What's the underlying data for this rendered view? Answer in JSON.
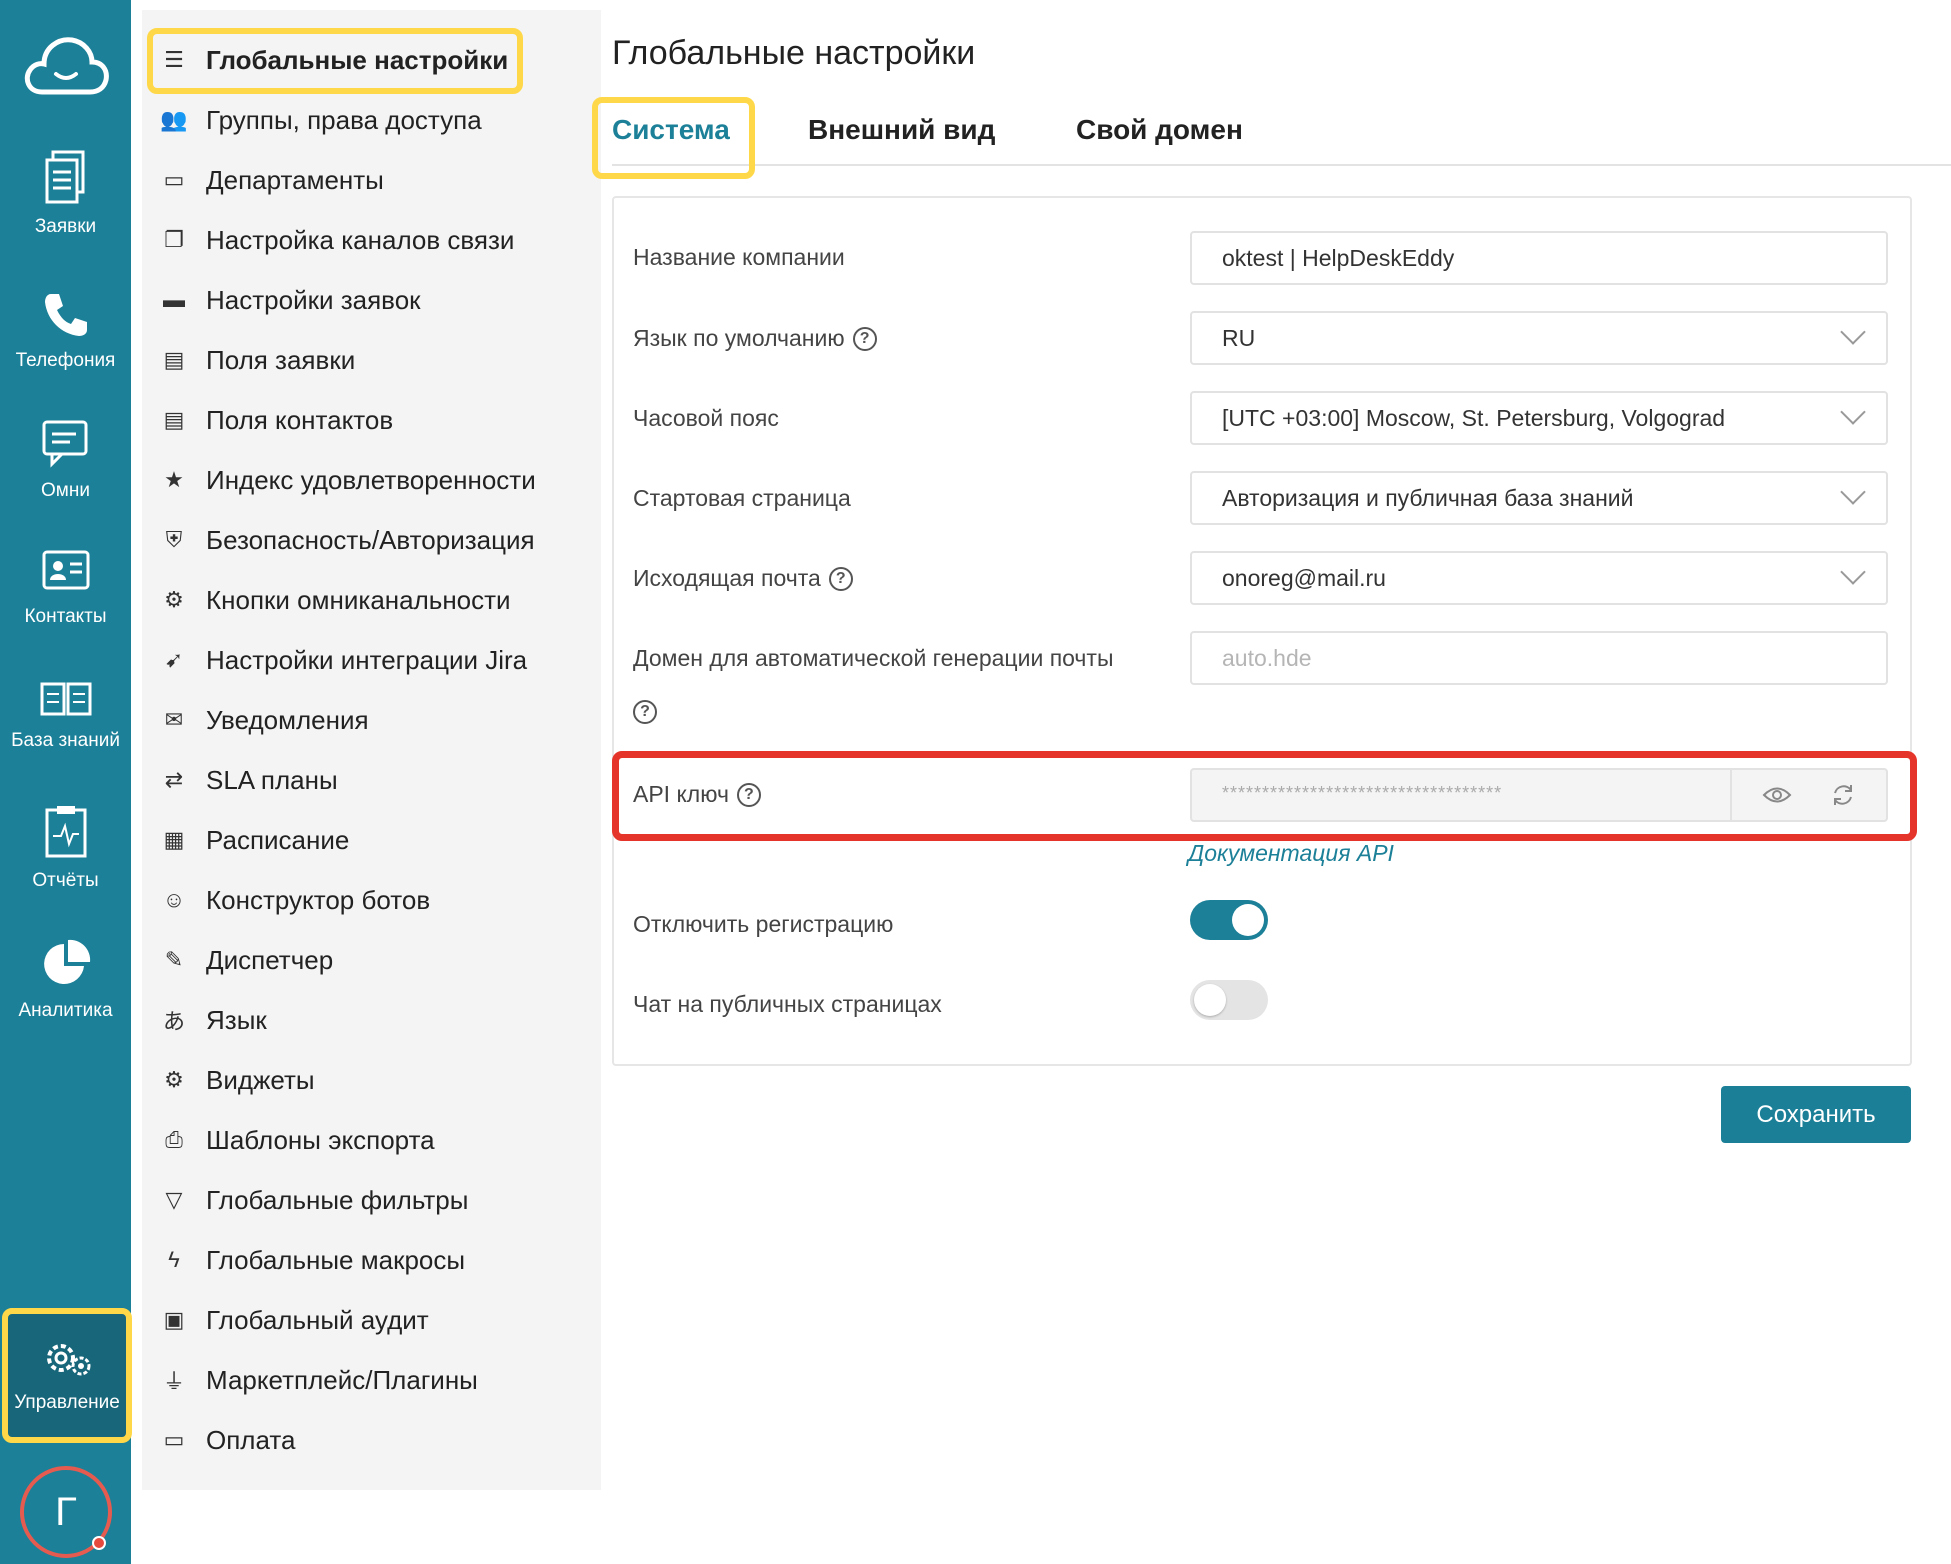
{
  "rail": {
    "items": [
      {
        "label": "Заявки",
        "icon": "tickets-icon"
      },
      {
        "label": "Телефония",
        "icon": "phone-icon"
      },
      {
        "label": "Омни",
        "icon": "chat-icon"
      },
      {
        "label": "Контакты",
        "icon": "contacts-icon"
      },
      {
        "label": "База знаний",
        "icon": "book-icon"
      },
      {
        "label": "Отчёты",
        "icon": "report-icon"
      },
      {
        "label": "Аналитика",
        "icon": "pie-chart-icon"
      }
    ],
    "active_label": "Управление",
    "avatar_letter": "Г"
  },
  "menu": {
    "items": [
      {
        "label": "Глобальные настройки",
        "icon": "sliders-icon"
      },
      {
        "label": "Группы, права доступа",
        "icon": "users-icon"
      },
      {
        "label": "Департаменты",
        "icon": "inbox-icon"
      },
      {
        "label": "Настройка каналов связи",
        "icon": "channels-icon"
      },
      {
        "label": "Настройки заявок",
        "icon": "window-icon"
      },
      {
        "label": "Поля заявки",
        "icon": "form-icon"
      },
      {
        "label": "Поля контактов",
        "icon": "form-icon"
      },
      {
        "label": "Индекс удовлетворенности",
        "icon": "star-icon"
      },
      {
        "label": "Безопасность/Авторизация",
        "icon": "shield-icon"
      },
      {
        "label": "Кнопки омниканальности",
        "icon": "gear-icon"
      },
      {
        "label": "Настройки интеграции Jira",
        "icon": "jira-icon"
      },
      {
        "label": "Уведомления",
        "icon": "envelope-icon"
      },
      {
        "label": "SLA планы",
        "icon": "handshake-icon"
      },
      {
        "label": "Расписание",
        "icon": "calendar-icon"
      },
      {
        "label": "Конструктор ботов",
        "icon": "bot-icon"
      },
      {
        "label": "Диспетчер",
        "icon": "magic-wand-icon"
      },
      {
        "label": "Язык",
        "icon": "language-icon"
      },
      {
        "label": "Виджеты",
        "icon": "gear-icon"
      },
      {
        "label": "Шаблоны экспорта",
        "icon": "printer-icon"
      },
      {
        "label": "Глобальные фильтры",
        "icon": "filter-icon"
      },
      {
        "label": "Глобальные макросы",
        "icon": "lightning-icon"
      },
      {
        "label": "Глобальный аудит",
        "icon": "audit-icon"
      },
      {
        "label": "Маркетплейс/Плагины",
        "icon": "plug-icon"
      },
      {
        "label": "Оплата",
        "icon": "payment-icon"
      }
    ]
  },
  "main": {
    "title": "Глобальные настройки",
    "tabs": [
      {
        "label": "Система"
      },
      {
        "label": "Внешний вид"
      },
      {
        "label": "Свой домен"
      }
    ],
    "fields": {
      "company": {
        "label": "Название компании",
        "value": "oktest | HelpDeskEddy"
      },
      "language": {
        "label": "Язык по умолчанию",
        "value": "RU"
      },
      "timezone": {
        "label": "Часовой пояс",
        "value": "[UTC +03:00] Moscow, St. Petersburg, Volgograd"
      },
      "start_page": {
        "label": "Стартовая страница",
        "value": "Авторизация и публичная база знаний"
      },
      "outgoing_mail": {
        "label": "Исходящая почта",
        "value": "onoreg@mail.ru"
      },
      "mail_domain": {
        "label": "Домен для автоматической генерации почты",
        "placeholder": "auto.hde"
      },
      "api_key": {
        "label": "API ключ",
        "value": "***********************************",
        "doc_link": "Документация API"
      }
    },
    "toggles": {
      "disable_registration": {
        "label": "Отключить регистрацию",
        "on": true
      },
      "public_chat": {
        "label": "Чат на публичных страницах",
        "on": false
      }
    },
    "save_label": "Сохранить"
  },
  "colors": {
    "accent": "#1c8098",
    "highlight_yellow": "#ffd84a",
    "highlight_red": "#e5342a"
  }
}
